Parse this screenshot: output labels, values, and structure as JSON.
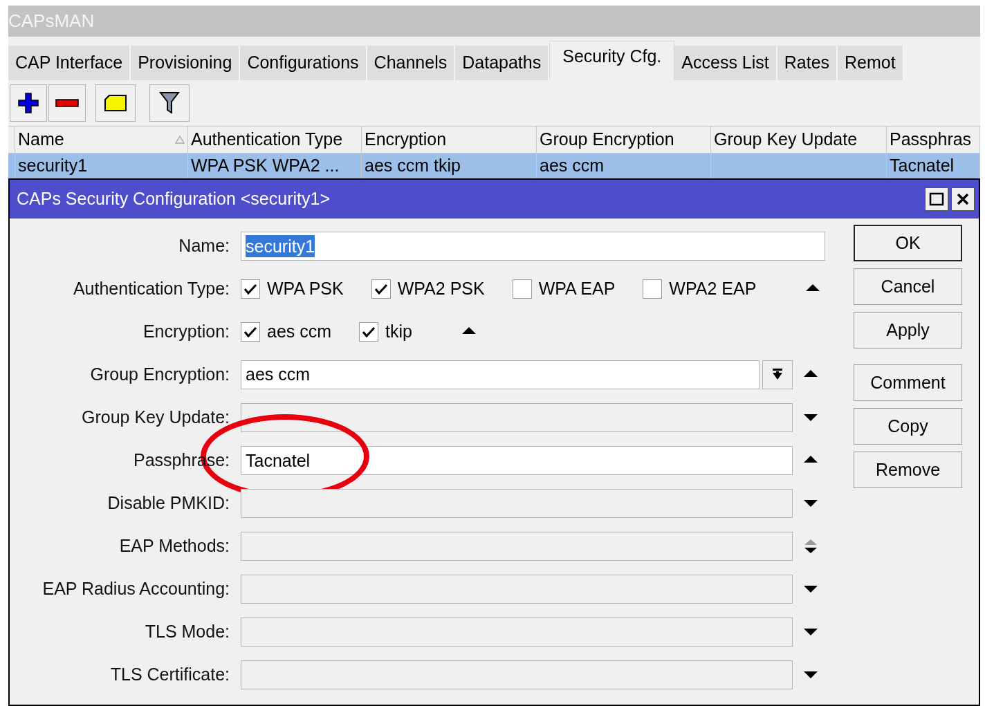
{
  "window": {
    "title": "CAPsMAN"
  },
  "tabs": [
    {
      "label": "CAP Interface",
      "selected": false
    },
    {
      "label": "Provisioning",
      "selected": false
    },
    {
      "label": "Configurations",
      "selected": false
    },
    {
      "label": "Channels",
      "selected": false
    },
    {
      "label": "Datapaths",
      "selected": false
    },
    {
      "label": "Security Cfg.",
      "selected": true
    },
    {
      "label": "Access List",
      "selected": false
    },
    {
      "label": "Rates",
      "selected": false
    },
    {
      "label": "Remot",
      "selected": false
    }
  ],
  "table": {
    "columns": [
      {
        "label": "Name",
        "sorted": true
      },
      {
        "label": "Authentication Type",
        "sorted": false
      },
      {
        "label": "Encryption",
        "sorted": false
      },
      {
        "label": "Group Encryption",
        "sorted": false
      },
      {
        "label": "Group Key Update",
        "sorted": false
      },
      {
        "label": "Passphras",
        "sorted": false
      }
    ],
    "rows": [
      {
        "selected": true,
        "cells": [
          "security1",
          "WPA PSK WPA2 ...",
          "aes ccm tkip",
          "aes ccm",
          "",
          "Tacnatel"
        ]
      }
    ]
  },
  "dialog": {
    "title": "CAPs Security Configuration <security1>",
    "fields": [
      {
        "kind": "text",
        "label": "Name:",
        "value": "security1",
        "value_selected": true,
        "set": true
      },
      {
        "kind": "checks",
        "label": "Authentication Type:",
        "options": [
          {
            "label": "WPA PSK",
            "checked": true
          },
          {
            "label": "WPA2 PSK",
            "checked": true
          },
          {
            "label": "WPA EAP",
            "checked": false
          },
          {
            "label": "WPA2 EAP",
            "checked": false
          }
        ],
        "arrow": {
          "kind": "up"
        }
      },
      {
        "kind": "checks",
        "label": "Encryption:",
        "options": [
          {
            "label": "aes ccm",
            "checked": true
          },
          {
            "label": "tkip",
            "checked": true
          }
        ],
        "arrow": {
          "kind": "up"
        }
      },
      {
        "kind": "combo",
        "label": "Group Encryption:",
        "value": "aes ccm",
        "set": true,
        "arrow": {
          "kind": "up"
        }
      },
      {
        "kind": "text",
        "label": "Group Key Update:",
        "set": false,
        "arrow": {
          "kind": "down"
        }
      },
      {
        "kind": "text",
        "label": "Passphrase:",
        "value": "Tacnatel",
        "value_selected": false,
        "set": true,
        "arrow": {
          "kind": "up"
        },
        "circled": true
      },
      {
        "kind": "text",
        "label": "Disable PMKID:",
        "set": false,
        "arrow": {
          "kind": "down"
        }
      },
      {
        "kind": "text",
        "label": "EAP Methods:",
        "set": false,
        "arrow": {
          "kind": "updown"
        }
      },
      {
        "kind": "text",
        "label": "EAP Radius Accounting:",
        "set": false,
        "arrow": {
          "kind": "down"
        }
      },
      {
        "kind": "text",
        "label": "TLS Mode:",
        "set": false,
        "arrow": {
          "kind": "down"
        }
      },
      {
        "kind": "text",
        "label": "TLS Certificate:",
        "set": false,
        "arrow": {
          "kind": "down"
        }
      }
    ],
    "button_groups": [
      [
        {
          "label": "OK",
          "default": true
        },
        {
          "label": "Cancel",
          "default": false
        },
        {
          "label": "Apply",
          "default": false
        }
      ],
      [
        {
          "label": "Comment",
          "default": false
        },
        {
          "label": "Copy",
          "default": false
        },
        {
          "label": "Remove",
          "default": false
        }
      ]
    ]
  }
}
